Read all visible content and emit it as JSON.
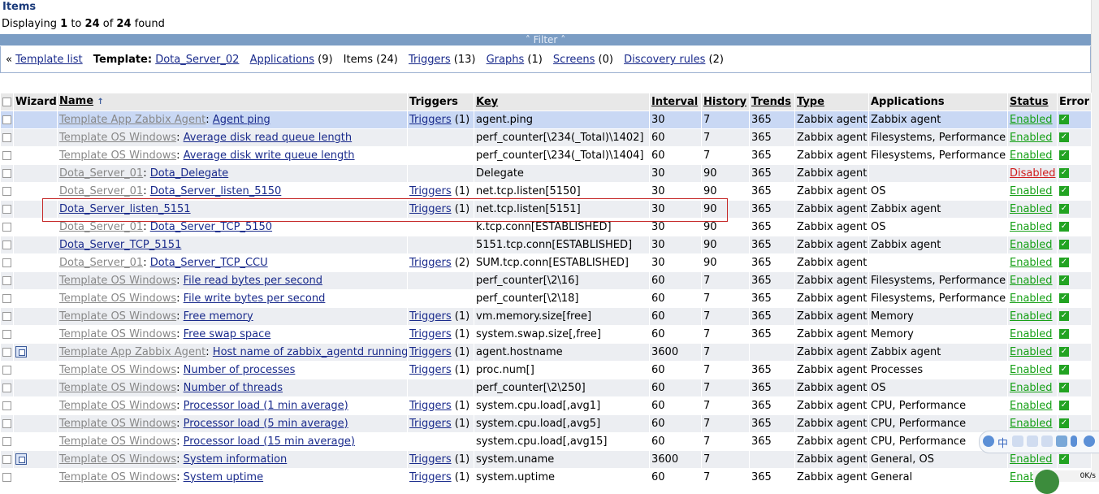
{
  "header": {
    "title": "Items",
    "displaying_prefix": "Displaying ",
    "from": "1",
    "to_word": " to ",
    "to": "24",
    "of_word": " of ",
    "total": "24",
    "found_word": " found"
  },
  "filter": {
    "label": "Filter",
    "arrow_left": "˄",
    "arrow_right": "˄"
  },
  "nav": {
    "back_symbol": "«",
    "template_list": "Template list",
    "template_label": "Template:",
    "template_name": "Dota_Server_02",
    "applications": "Applications",
    "applications_count": " (9)",
    "items": "Items (24)",
    "triggers": "Triggers",
    "triggers_count": " (13)",
    "graphs": "Graphs",
    "graphs_count": " (1)",
    "screens": "Screens",
    "screens_count": " (0)",
    "discovery": "Discovery rules",
    "discovery_count": " (2)"
  },
  "columns": {
    "wizard": "Wizard",
    "name": "Name",
    "triggers": "Triggers",
    "key": "Key",
    "interval": "Interval",
    "history": "History",
    "trends": "Trends",
    "type": "Type",
    "applications": "Applications",
    "status": "Status",
    "error": "Error"
  },
  "rows": [
    {
      "prefix": "Template App Zabbix Agent",
      "name": "Agent ping",
      "triggers": "Triggers",
      "tcount": " (1)",
      "key": "agent.ping",
      "interval": "30",
      "history": "7",
      "trends": "365",
      "type": "Zabbix agent",
      "apps": "Zabbix agent",
      "status": "Enabled",
      "wizard": false
    },
    {
      "prefix": "Template OS Windows",
      "name": "Average disk read queue length",
      "triggers": "",
      "tcount": "",
      "key": "perf_counter[\\234(_Total)\\1402]",
      "interval": "60",
      "history": "7",
      "trends": "365",
      "type": "Zabbix agent",
      "apps": "Filesystems, Performance",
      "status": "Enabled",
      "wizard": false
    },
    {
      "prefix": "Template OS Windows",
      "name": "Average disk write queue length",
      "triggers": "",
      "tcount": "",
      "key": "perf_counter[\\234(_Total)\\1404]",
      "interval": "60",
      "history": "7",
      "trends": "365",
      "type": "Zabbix agent",
      "apps": "Filesystems, Performance",
      "status": "Enabled",
      "wizard": false
    },
    {
      "prefix": "Dota_Server_01",
      "name": "Dota_Delegate",
      "triggers": "",
      "tcount": "",
      "key": "Delegate",
      "interval": "30",
      "history": "90",
      "trends": "365",
      "type": "Zabbix agent",
      "apps": "",
      "status": "Disabled",
      "wizard": false
    },
    {
      "prefix": "Dota_Server_01",
      "name": "Dota_Server_listen_5150",
      "triggers": "Triggers",
      "tcount": " (1)",
      "key": "net.tcp.listen[5150]",
      "interval": "30",
      "history": "90",
      "trends": "365",
      "type": "Zabbix agent",
      "apps": "OS",
      "status": "Enabled",
      "wizard": false
    },
    {
      "prefix": "",
      "name": "Dota_Server_listen_5151",
      "triggers": "Triggers",
      "tcount": " (1)",
      "key": "net.tcp.listen[5151]",
      "interval": "30",
      "history": "90",
      "trends": "365",
      "type": "Zabbix agent",
      "apps": "Zabbix agent",
      "status": "Enabled",
      "wizard": false
    },
    {
      "prefix": "Dota_Server_01",
      "name": "Dota_Server_TCP_5150",
      "triggers": "",
      "tcount": "",
      "key": "k.tcp.conn[ESTABLISHED]",
      "interval": "30",
      "history": "90",
      "trends": "365",
      "type": "Zabbix agent",
      "apps": "OS",
      "status": "Enabled",
      "wizard": false
    },
    {
      "prefix": "",
      "name": "Dota_Server_TCP_5151",
      "triggers": "",
      "tcount": "",
      "key": "5151.tcp.conn[ESTABLISHED]",
      "interval": "30",
      "history": "90",
      "trends": "365",
      "type": "Zabbix agent",
      "apps": "Zabbix agent",
      "status": "Enabled",
      "wizard": false
    },
    {
      "prefix": "Dota_Server_01",
      "name": "Dota_Server_TCP_CCU",
      "triggers": "Triggers",
      "tcount": " (2)",
      "key": "SUM.tcp.conn[ESTABLISHED]",
      "interval": "30",
      "history": "90",
      "trends": "365",
      "type": "Zabbix agent",
      "apps": "",
      "status": "Enabled",
      "wizard": false
    },
    {
      "prefix": "Template OS Windows",
      "name": "File read bytes per second",
      "triggers": "",
      "tcount": "",
      "key": "perf_counter[\\2\\16]",
      "interval": "60",
      "history": "7",
      "trends": "365",
      "type": "Zabbix agent",
      "apps": "Filesystems, Performance",
      "status": "Enabled",
      "wizard": false
    },
    {
      "prefix": "Template OS Windows",
      "name": "File write bytes per second",
      "triggers": "",
      "tcount": "",
      "key": "perf_counter[\\2\\18]",
      "interval": "60",
      "history": "7",
      "trends": "365",
      "type": "Zabbix agent",
      "apps": "Filesystems, Performance",
      "status": "Enabled",
      "wizard": false
    },
    {
      "prefix": "Template OS Windows",
      "name": "Free memory",
      "triggers": "Triggers",
      "tcount": " (1)",
      "key": "vm.memory.size[free]",
      "interval": "60",
      "history": "7",
      "trends": "365",
      "type": "Zabbix agent",
      "apps": "Memory",
      "status": "Enabled",
      "wizard": false
    },
    {
      "prefix": "Template OS Windows",
      "name": "Free swap space",
      "triggers": "Triggers",
      "tcount": " (1)",
      "key": "system.swap.size[,free]",
      "interval": "60",
      "history": "7",
      "trends": "365",
      "type": "Zabbix agent",
      "apps": "Memory",
      "status": "Enabled",
      "wizard": false
    },
    {
      "prefix": "Template App Zabbix Agent",
      "name": "Host name of zabbix_agentd running",
      "triggers": "Triggers",
      "tcount": " (1)",
      "key": "agent.hostname",
      "interval": "3600",
      "history": "7",
      "trends": "",
      "type": "Zabbix agent",
      "apps": "Zabbix agent",
      "status": "Enabled",
      "wizard": true
    },
    {
      "prefix": "Template OS Windows",
      "name": "Number of processes",
      "triggers": "Triggers",
      "tcount": " (1)",
      "key": "proc.num[]",
      "interval": "60",
      "history": "7",
      "trends": "365",
      "type": "Zabbix agent",
      "apps": "Processes",
      "status": "Enabled",
      "wizard": false
    },
    {
      "prefix": "Template OS Windows",
      "name": "Number of threads",
      "triggers": "",
      "tcount": "",
      "key": "perf_counter[\\2\\250]",
      "interval": "60",
      "history": "7",
      "trends": "365",
      "type": "Zabbix agent",
      "apps": "OS",
      "status": "Enabled",
      "wizard": false
    },
    {
      "prefix": "Template OS Windows",
      "name": "Processor load (1 min average)",
      "triggers": "Triggers",
      "tcount": " (1)",
      "key": "system.cpu.load[,avg1]",
      "interval": "60",
      "history": "7",
      "trends": "365",
      "type": "Zabbix agent",
      "apps": "CPU, Performance",
      "status": "Enabled",
      "wizard": false
    },
    {
      "prefix": "Template OS Windows",
      "name": "Processor load (5 min average)",
      "triggers": "Triggers",
      "tcount": " (1)",
      "key": "system.cpu.load[,avg5]",
      "interval": "60",
      "history": "7",
      "trends": "365",
      "type": "Zabbix agent",
      "apps": "CPU, Performance",
      "status": "Enabled",
      "wizard": false
    },
    {
      "prefix": "Template OS Windows",
      "name": "Processor load (15 min average)",
      "triggers": "",
      "tcount": "",
      "key": "system.cpu.load[,avg15]",
      "interval": "60",
      "history": "7",
      "trends": "365",
      "type": "Zabbix agent",
      "apps": "CPU, Performance",
      "status": "Enabled",
      "wizard": false
    },
    {
      "prefix": "Template OS Windows",
      "name": "System information",
      "triggers": "Triggers",
      "tcount": " (1)",
      "key": "system.uname",
      "interval": "3600",
      "history": "7",
      "trends": "",
      "type": "Zabbix agent",
      "apps": "General, OS",
      "status": "Enabled",
      "wizard": true
    },
    {
      "prefix": "Template OS Windows",
      "name": "System uptime",
      "triggers": "Triggers",
      "tcount": " (1)",
      "key": "system.uptime",
      "interval": "60",
      "history": "7",
      "trends": "365",
      "type": "Zabbix agent",
      "apps": "General",
      "status": "Enabled",
      "wizard": false
    }
  ],
  "tray": {
    "ime_text": "中",
    "net_speed": "0K/s"
  },
  "colors": {
    "enabled": "#16a016",
    "disabled": "#d01c1c",
    "link": "#1a2b8c",
    "filter_bar": "#7b9dc4",
    "highlight": "#c52828"
  }
}
